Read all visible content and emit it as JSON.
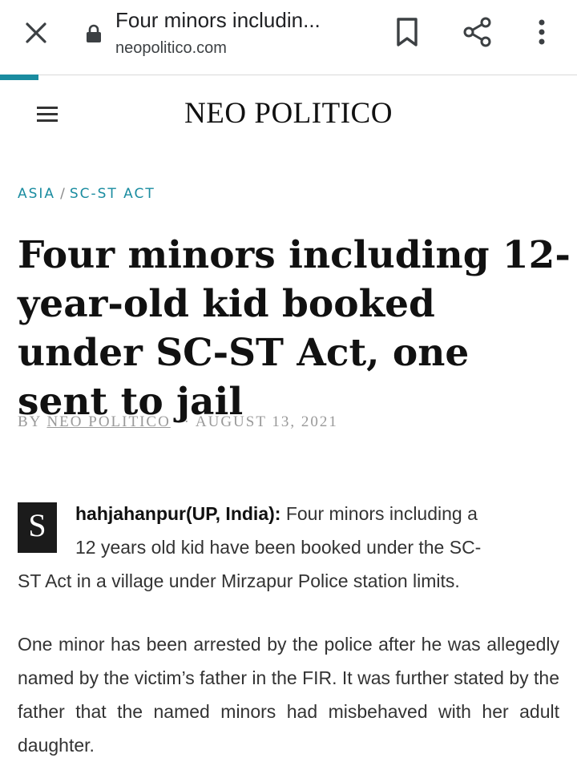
{
  "browser": {
    "tab_title": "Four minors includin...",
    "domain": "neopolitico.com",
    "page_load_progress": 0.067
  },
  "site": {
    "title": "NEO POLITICO"
  },
  "breadcrumb": {
    "items": [
      "ASIA",
      "SC-ST ACT"
    ],
    "separator": "/"
  },
  "article": {
    "headline": "Four minors including 12-year-old kid booked under SC-ST Act, one sent to jail",
    "byline_prefix": "BY",
    "author": "NEO POLITICO",
    "date_separator": "·",
    "date": "AUGUST 13, 2021",
    "dropcap": "S",
    "lead_strong": "hahjahanpur(UP, India):",
    "lead_line1_rest": "Four minors including a",
    "lead_line2": "12 years old kid have been booked under the SC-",
    "lead_line3": "ST Act in a village under Mirzapur Police station limits.",
    "paragraph2": "One minor has been arrested by the police after he was allegedly named by the victim’s father in the FIR. It was further stated by the father that the named minors had misbehaved with her adult daughter."
  },
  "colors": {
    "accent": "#1a8ca0",
    "dropcap_bg": "#1b1b1b",
    "meta_gray": "#999999"
  }
}
